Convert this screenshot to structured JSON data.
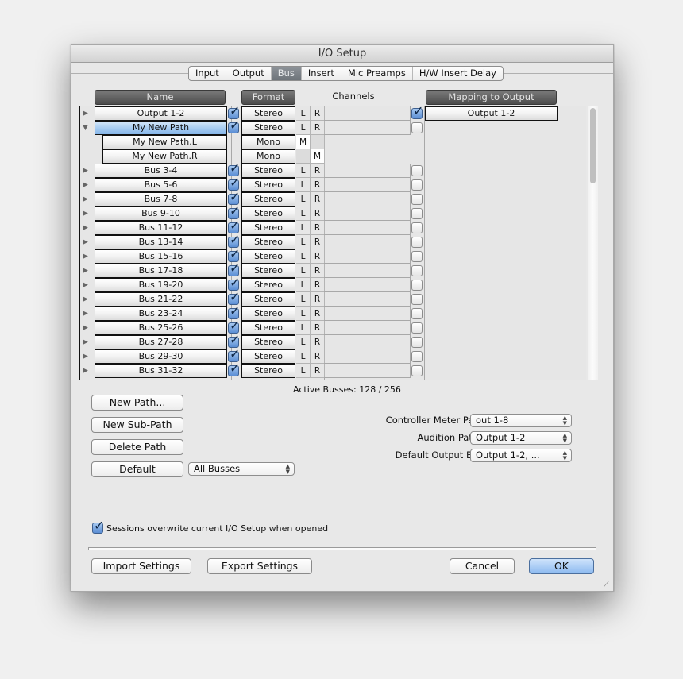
{
  "window": {
    "title": "I/O Setup"
  },
  "tabs": [
    {
      "label": "Input",
      "active": false
    },
    {
      "label": "Output",
      "active": false
    },
    {
      "label": "Bus",
      "active": true
    },
    {
      "label": "Insert",
      "active": false
    },
    {
      "label": "Mic Preamps",
      "active": false
    },
    {
      "label": "H/W Insert Delay",
      "active": false
    }
  ],
  "columns": {
    "name": "Name",
    "format": "Format",
    "channels": "Channels",
    "mapping": "Mapping to Output"
  },
  "rows": [
    {
      "name": "Output 1-2",
      "expanded": false,
      "active": true,
      "format": "Stereo",
      "channels": [
        "L",
        "R"
      ],
      "mapped": true,
      "mapping": "Output 1-2"
    },
    {
      "name": "My New Path",
      "expanded": true,
      "selected": true,
      "active": true,
      "format": "Stereo",
      "channels": [
        "L",
        "R"
      ],
      "mapped": false
    },
    {
      "name": "My New Path.L",
      "sub": true,
      "format": "Mono",
      "channels": [
        "M",
        ""
      ]
    },
    {
      "name": "My New Path.R",
      "sub": true,
      "format": "Mono",
      "channels": [
        "",
        "M"
      ]
    },
    {
      "name": "Bus 3-4",
      "active": true,
      "format": "Stereo",
      "channels": [
        "L",
        "R"
      ],
      "mapped": false
    },
    {
      "name": "Bus 5-6",
      "active": true,
      "format": "Stereo",
      "channels": [
        "L",
        "R"
      ],
      "mapped": false
    },
    {
      "name": "Bus 7-8",
      "active": true,
      "format": "Stereo",
      "channels": [
        "L",
        "R"
      ],
      "mapped": false
    },
    {
      "name": "Bus 9-10",
      "active": true,
      "format": "Stereo",
      "channels": [
        "L",
        "R"
      ],
      "mapped": false
    },
    {
      "name": "Bus 11-12",
      "active": true,
      "format": "Stereo",
      "channels": [
        "L",
        "R"
      ],
      "mapped": false
    },
    {
      "name": "Bus 13-14",
      "active": true,
      "format": "Stereo",
      "channels": [
        "L",
        "R"
      ],
      "mapped": false
    },
    {
      "name": "Bus 15-16",
      "active": true,
      "format": "Stereo",
      "channels": [
        "L",
        "R"
      ],
      "mapped": false
    },
    {
      "name": "Bus 17-18",
      "active": true,
      "format": "Stereo",
      "channels": [
        "L",
        "R"
      ],
      "mapped": false
    },
    {
      "name": "Bus 19-20",
      "active": true,
      "format": "Stereo",
      "channels": [
        "L",
        "R"
      ],
      "mapped": false
    },
    {
      "name": "Bus 21-22",
      "active": true,
      "format": "Stereo",
      "channels": [
        "L",
        "R"
      ],
      "mapped": false
    },
    {
      "name": "Bus 23-24",
      "active": true,
      "format": "Stereo",
      "channels": [
        "L",
        "R"
      ],
      "mapped": false
    },
    {
      "name": "Bus 25-26",
      "active": true,
      "format": "Stereo",
      "channels": [
        "L",
        "R"
      ],
      "mapped": false
    },
    {
      "name": "Bus 27-28",
      "active": true,
      "format": "Stereo",
      "channels": [
        "L",
        "R"
      ],
      "mapped": false
    },
    {
      "name": "Bus 29-30",
      "active": true,
      "format": "Stereo",
      "channels": [
        "L",
        "R"
      ],
      "mapped": false
    },
    {
      "name": "Bus 31-32",
      "active": true,
      "format": "Stereo",
      "channels": [
        "L",
        "R"
      ],
      "mapped": false
    }
  ],
  "icons": {
    "disclosure_closed": "▶",
    "disclosure_open": "▼",
    "checkmark": "✓",
    "popup_arrows": "▲▼",
    "resize_grip": "⟋"
  },
  "active_busses": "Active Busses: 128 / 256",
  "buttons": {
    "new_path": "New Path...",
    "new_sub_path": "New Sub-Path",
    "delete_path": "Delete Path",
    "default": "Default",
    "import_settings": "Import Settings",
    "export_settings": "Export Settings",
    "cancel": "Cancel",
    "ok": "OK"
  },
  "default_scope": {
    "value": "All Busses"
  },
  "settings": {
    "controller_meter_path": {
      "label": "Controller Meter Path:",
      "value": "out 1-8"
    },
    "audition_paths": {
      "label": "Audition Paths:",
      "value": "Output 1-2"
    },
    "default_output_bus": {
      "label": "Default Output Bus:",
      "value": "Output 1-2, ..."
    }
  },
  "sessions_overwrite": {
    "label": "Sessions overwrite current I/O Setup when opened",
    "checked": true
  }
}
